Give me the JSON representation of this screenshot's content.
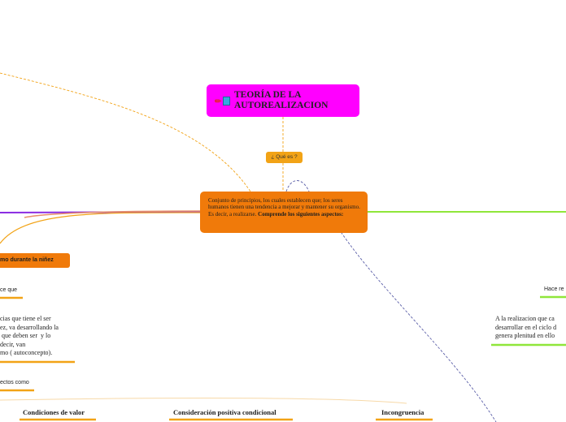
{
  "title": "TEORÍA DE LA AUTOREALIZACION",
  "question": "¿ Qué es ?",
  "definition": {
    "text": "Conjunto de principios, los cuales establecen que; los seres humanos tienen una tendencia a mejorar y mantener su organismo. Es decir, a realizarse.",
    "bold_text": "Comprende los siguientes aspectos:"
  },
  "left_branch": {
    "topic": "mo durante la niñez",
    "sub_label": "ce que",
    "paragraph_lines": [
      "cias que tiene el ser",
      "ez, va desarrollando la",
      " que deben ser  y lo",
      "decir, van",
      "mo ( autoconcepto)."
    ],
    "aspects_label": "ectos como",
    "aspects": [
      "Condiciones de valor",
      "Consideración positiva condicional",
      "Incongruencia"
    ]
  },
  "right_branch": {
    "sub_label": "Hace re",
    "paragraph_lines": [
      "A la realizacion que ca",
      "desarrollar en el ciclo d",
      "genera plenitud en ello"
    ]
  },
  "colors": {
    "title_bg": "#ff00ff",
    "question_bg": "#f2a316",
    "main_bg": "#f07a0a",
    "left_line": "#8a2be2",
    "right_line": "#8fe63a",
    "underline": "#f2a316"
  }
}
